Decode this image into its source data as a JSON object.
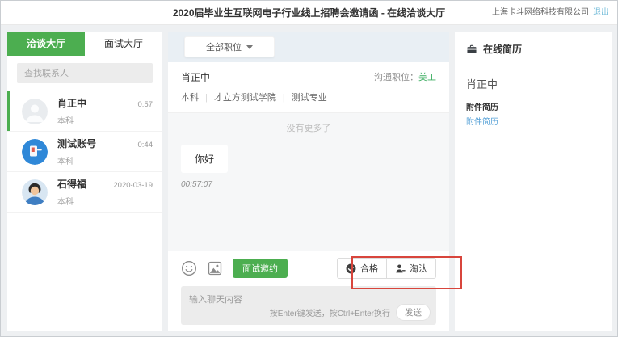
{
  "header": {
    "title": "2020届毕业生互联网电子行业线上招聘会邀请函 - 在线洽谈大厅",
    "company": "上海卡斗网络科技有限公司",
    "logout": "退出"
  },
  "sidebar": {
    "tabs": [
      {
        "label": "洽谈大厅"
      },
      {
        "label": "面试大厅"
      }
    ],
    "search_placeholder": "查找联系人",
    "contacts": [
      {
        "name": "肖正中",
        "degree": "本科",
        "time": "0:57"
      },
      {
        "name": "测试账号",
        "degree": "本科",
        "time": "0:44"
      },
      {
        "name": "石得福",
        "degree": "本科",
        "time": "2020-03-19"
      }
    ]
  },
  "chat": {
    "filter_label": "全部职位",
    "peer": {
      "name": "肖正中",
      "degree": "本科",
      "school": "才立方测试学院",
      "major": "测试专业",
      "position_label": "沟通职位：",
      "position_value": "美工"
    },
    "no_more_text": "没有更多了",
    "message": {
      "text": "你好",
      "time": "00:57:07"
    },
    "toolbar": {
      "invite_label": "面试邀约",
      "pass_label": "合格",
      "reject_label": "淘汰"
    },
    "input_placeholder": "输入聊天内容",
    "send_hint": "按Enter键发送，按Ctrl+Enter换行",
    "send_label": "发送"
  },
  "resume": {
    "title": "在线简历",
    "name": "肖正中",
    "attachment_label": "附件简历",
    "attachment_link": "附件简历"
  },
  "colors": {
    "accent_green": "#4cae50",
    "annotation_red": "#d8453c",
    "link_blue": "#56a1d7",
    "position_green": "#3dae62"
  }
}
